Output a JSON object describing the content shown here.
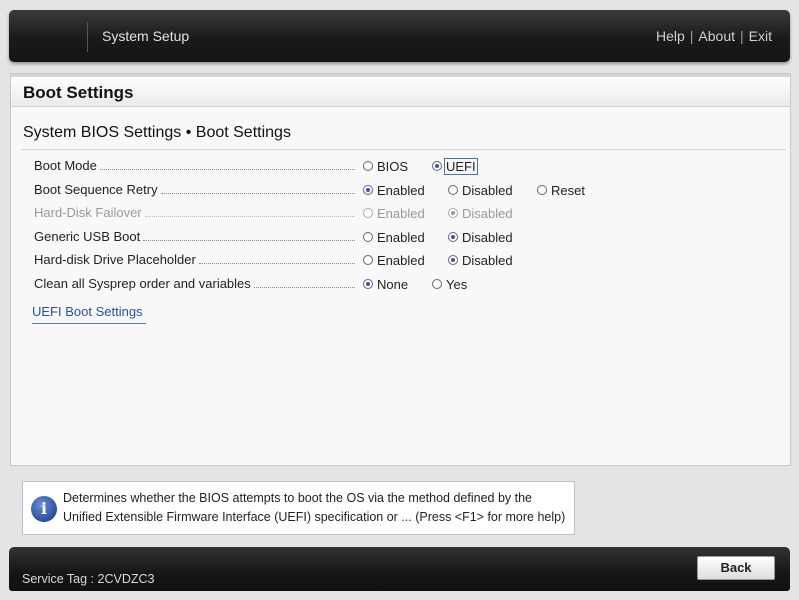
{
  "header": {
    "title": "System Setup",
    "links": {
      "help": "Help",
      "about": "About",
      "exit": "Exit",
      "separator": "|"
    }
  },
  "page": {
    "title": "Boot Settings",
    "subtitle": "System BIOS Settings • Boot Settings"
  },
  "settings": [
    {
      "label": "Boot Mode",
      "disabled": false,
      "options": [
        {
          "label": "BIOS",
          "checked": false
        },
        {
          "label": "UEFI",
          "checked": true,
          "focused": true
        }
      ]
    },
    {
      "label": "Boot Sequence Retry",
      "disabled": false,
      "options": [
        {
          "label": "Enabled",
          "checked": true
        },
        {
          "label": "Disabled",
          "checked": false
        },
        {
          "label": "Reset",
          "checked": false
        }
      ]
    },
    {
      "label": "Hard-Disk Failover",
      "disabled": true,
      "options": [
        {
          "label": "Enabled",
          "checked": false
        },
        {
          "label": "Disabled",
          "checked": true
        }
      ]
    },
    {
      "label": "Generic USB Boot",
      "disabled": false,
      "options": [
        {
          "label": "Enabled",
          "checked": false
        },
        {
          "label": "Disabled",
          "checked": true
        }
      ]
    },
    {
      "label": "Hard-disk Drive Placeholder",
      "disabled": false,
      "options": [
        {
          "label": "Enabled",
          "checked": false
        },
        {
          "label": "Disabled",
          "checked": true
        }
      ]
    },
    {
      "label": "Clean all Sysprep order and variables",
      "disabled": false,
      "options": [
        {
          "label": "None",
          "checked": true
        },
        {
          "label": "Yes",
          "checked": false
        }
      ]
    }
  ],
  "links": {
    "uefi_boot_settings": "UEFI Boot Settings"
  },
  "help": {
    "icon": "info-icon",
    "line1": "Determines whether the BIOS attempts to boot the OS via the method defined by the",
    "line2": "Unified Extensible Firmware Interface (UEFI) specification or ... (Press <F1> for more help)"
  },
  "footer": {
    "service_tag": "Service Tag : 2CVDZC3",
    "back_label": "Back"
  },
  "colors": {
    "accent": "#3b56b0",
    "link": "#2d4f9e",
    "bar_dark": "#1a1a1a",
    "panel_bg": "#f8f8f8"
  }
}
